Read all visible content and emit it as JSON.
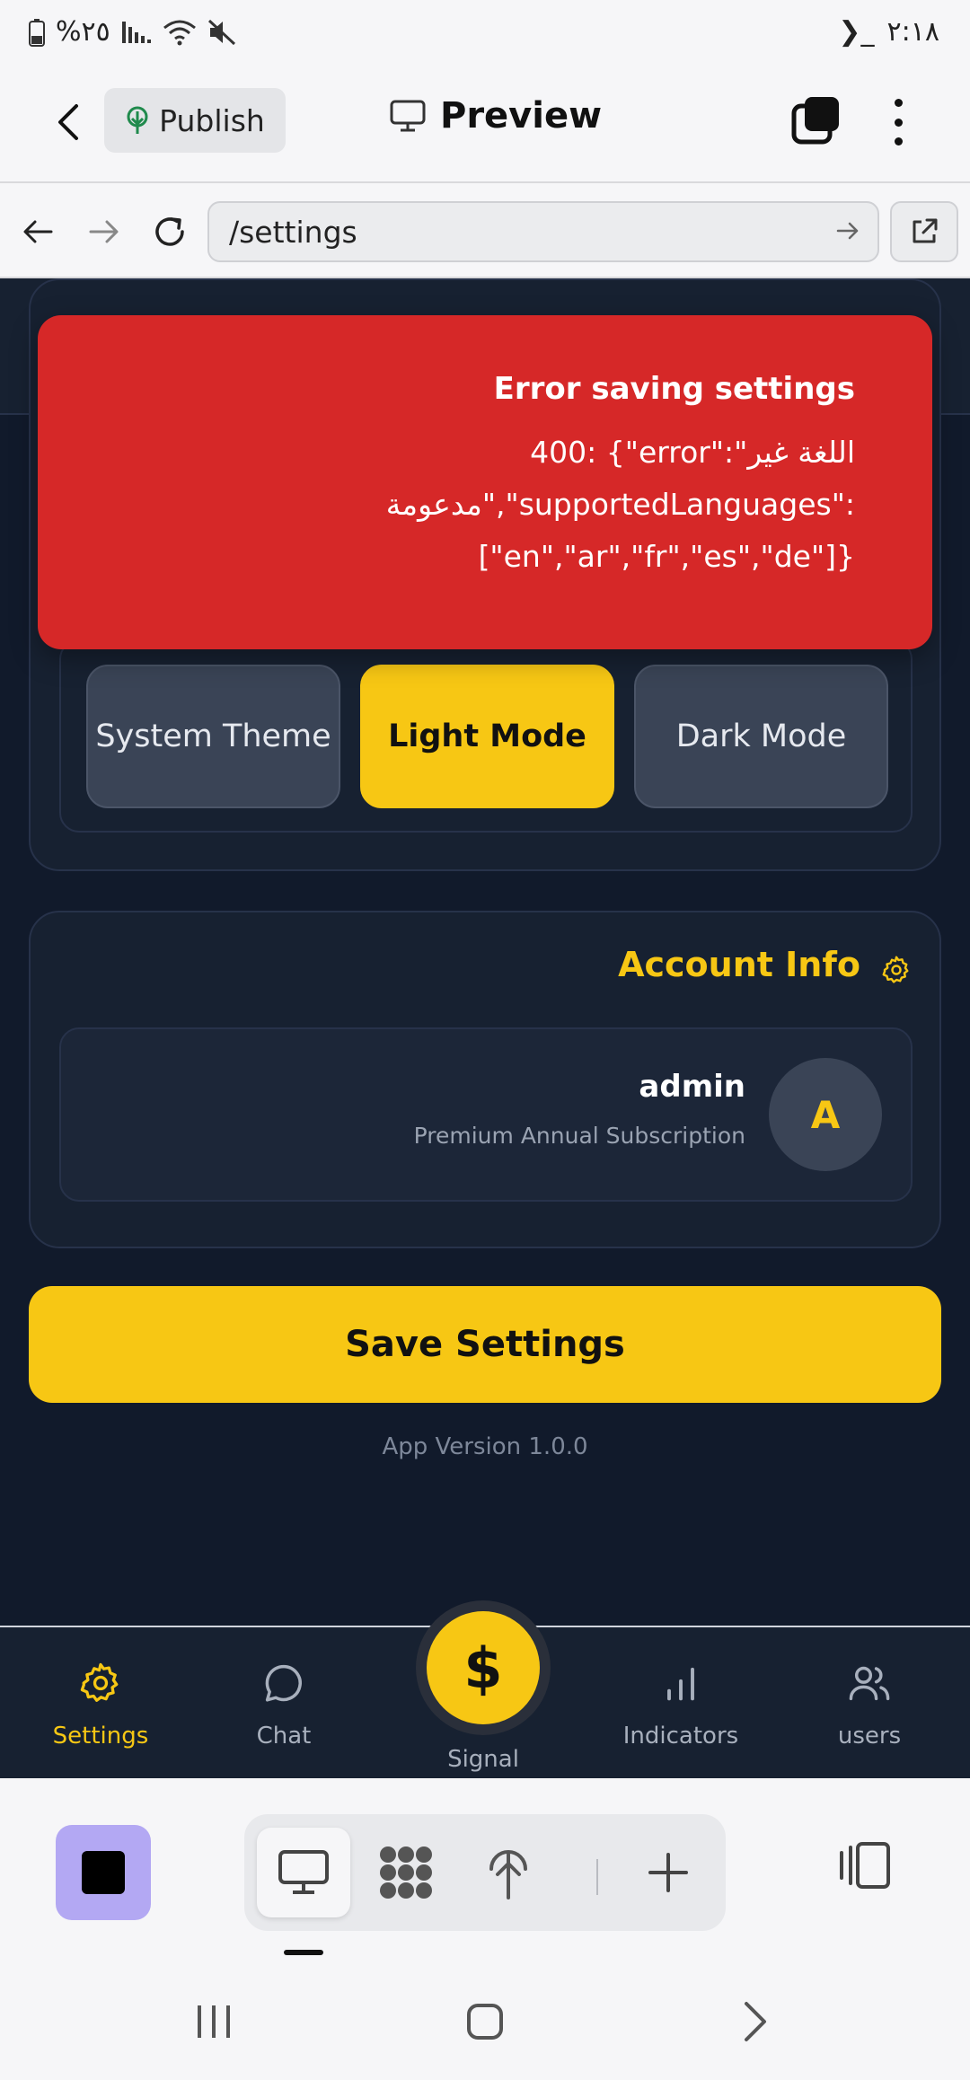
{
  "status_bar": {
    "time": "٢:١٨",
    "battery": "%٢٥",
    "terminal_glyph": "❯_"
  },
  "app_bar": {
    "publish_label": "Publish",
    "preview_label": "Preview"
  },
  "url_bar": {
    "url": "/settings"
  },
  "theme": {
    "options": [
      {
        "label": "System Theme",
        "active": false
      },
      {
        "label": "Light Mode",
        "active": true
      },
      {
        "label": "Dark Mode",
        "active": false
      }
    ]
  },
  "error_toast": {
    "title": "Error saving settings",
    "message": "400: {\"error\":\"اللغة غير مدعومة\",\"supportedLanguages\":[\"en\",\"ar\",\"fr\",\"es\",\"de\"]}"
  },
  "account": {
    "title": "Account Info",
    "name": "admin",
    "subscription": "Premium Annual Subscription",
    "avatar_letter": "A"
  },
  "save_label": "Save Settings",
  "version": "App Version 1.0.0",
  "tabs": {
    "settings": "Settings",
    "chat": "Chat",
    "signal": "Signal",
    "signal_symbol": "$",
    "indicators": "Indicators",
    "users": "users"
  },
  "colors": {
    "accent": "#f7c714",
    "background": "#111a2b",
    "card": "#172131",
    "error": "#d62828",
    "editor_square": "#b3a8f3"
  },
  "icons": [
    "back-arrow-icon",
    "tree-icon",
    "monitor-icon",
    "tabs-icon",
    "more-vertical-icon",
    "arrow-left-icon",
    "arrow-right-icon",
    "reload-icon",
    "go-arrow-icon",
    "external-link-icon",
    "gear-icon",
    "chat-bubble-icon",
    "bar-chart-icon",
    "users-icon",
    "grid-icon",
    "plus-icon",
    "panel-icon"
  ]
}
